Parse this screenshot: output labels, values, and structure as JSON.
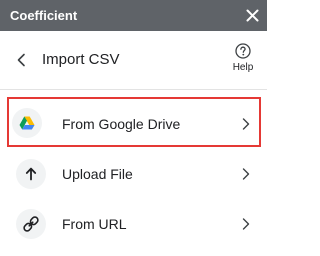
{
  "titlebar": {
    "app_name": "Coefficient"
  },
  "header": {
    "title": "Import CSV",
    "help_label": "Help"
  },
  "options": [
    {
      "label": "From Google Drive",
      "icon": "google-drive-icon",
      "selected": true
    },
    {
      "label": "Upload File",
      "icon": "upload-arrow-icon",
      "selected": false
    },
    {
      "label": "From URL",
      "icon": "link-icon",
      "selected": false
    }
  ],
  "colors": {
    "titlebar_bg": "#5f6368",
    "selected_border": "#e53935",
    "icon_bg": "#f1f3f4",
    "text": "#202124"
  }
}
